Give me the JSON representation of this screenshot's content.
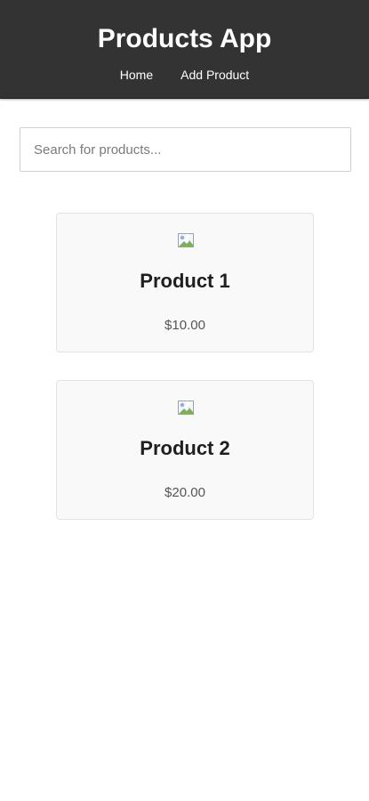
{
  "header": {
    "title": "Products App",
    "nav": [
      {
        "label": "Home"
      },
      {
        "label": "Add Product"
      }
    ],
    "background_color": "#333333"
  },
  "search": {
    "value": "",
    "placeholder": "Search for products..."
  },
  "products": [
    {
      "name": "Product 1",
      "price": "$10.00",
      "image_icon": "broken-image-icon"
    },
    {
      "name": "Product 2",
      "price": "$20.00",
      "image_icon": "broken-image-icon"
    }
  ]
}
